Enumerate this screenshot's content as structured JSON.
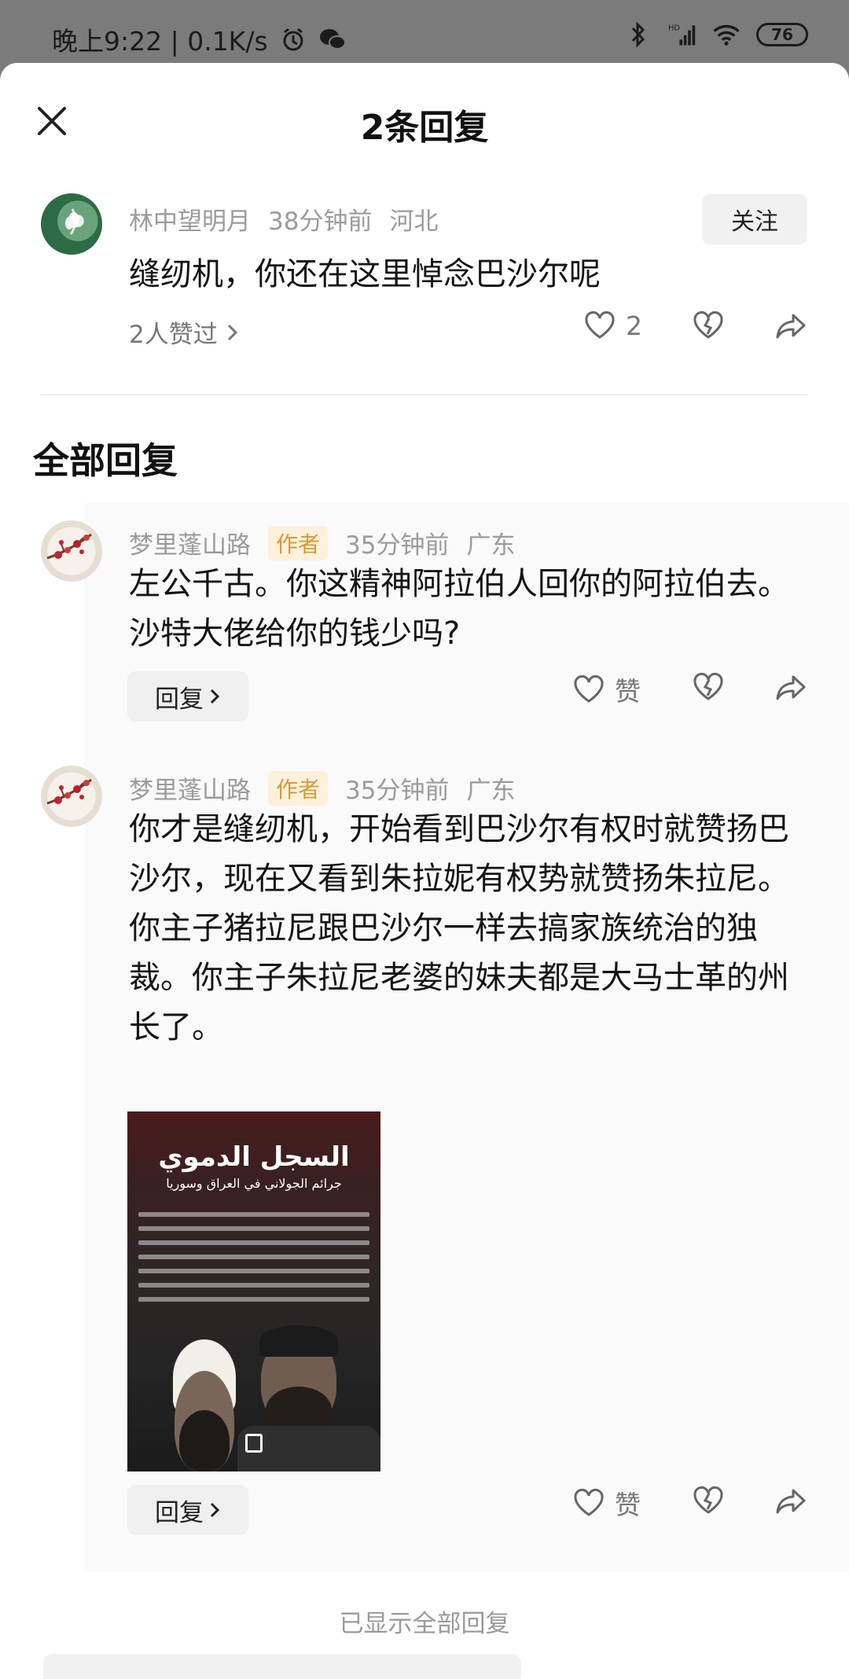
{
  "status_bar": {
    "time_speed": "晚上9:22 | 0.1K/s",
    "network": "HD",
    "battery": "76"
  },
  "sheet": {
    "title": "2条回复",
    "close_icon": "close-icon"
  },
  "root_comment": {
    "username": "林中望明月",
    "time": "38分钟前",
    "location": "河北",
    "follow_label": "关注",
    "text": "缝纫机，你还在这里悼念巴沙尔呢",
    "likes_summary": "2人赞过",
    "like_count": "2"
  },
  "section_title": "全部回复",
  "replies": [
    {
      "username": "梦里蓬山路",
      "author_tag": "作者",
      "time": "35分钟前",
      "location": "广东",
      "text": "左公千古。你这精神阿拉伯人回你的阿拉伯去。沙特大佬给你的钱少吗?",
      "reply_label": "回复",
      "like_label": "赞"
    },
    {
      "username": "梦里蓬山路",
      "author_tag": "作者",
      "time": "35分钟前",
      "location": "广东",
      "text": "你才是缝纫机，开始看到巴沙尔有权时就赞扬巴沙尔，现在又看到朱拉妮有权势就赞扬朱拉尼。\n你主子猪拉尼跟巴沙尔一样去搞家族统治的独裁。你主子朱拉尼老婆的妹夫都是大马士革的州长了。",
      "image": {
        "title": "السجل الدموي",
        "subtitle": "جرائم الجولاني في العراق وسوريا"
      },
      "reply_label": "回复",
      "like_label": "赞"
    }
  ],
  "footer_note": "已显示全部回复",
  "colors": {
    "author_tag_bg": "#fdf1dc",
    "author_tag_text": "#d79a37",
    "meta_gray": "#9b9b9b"
  }
}
